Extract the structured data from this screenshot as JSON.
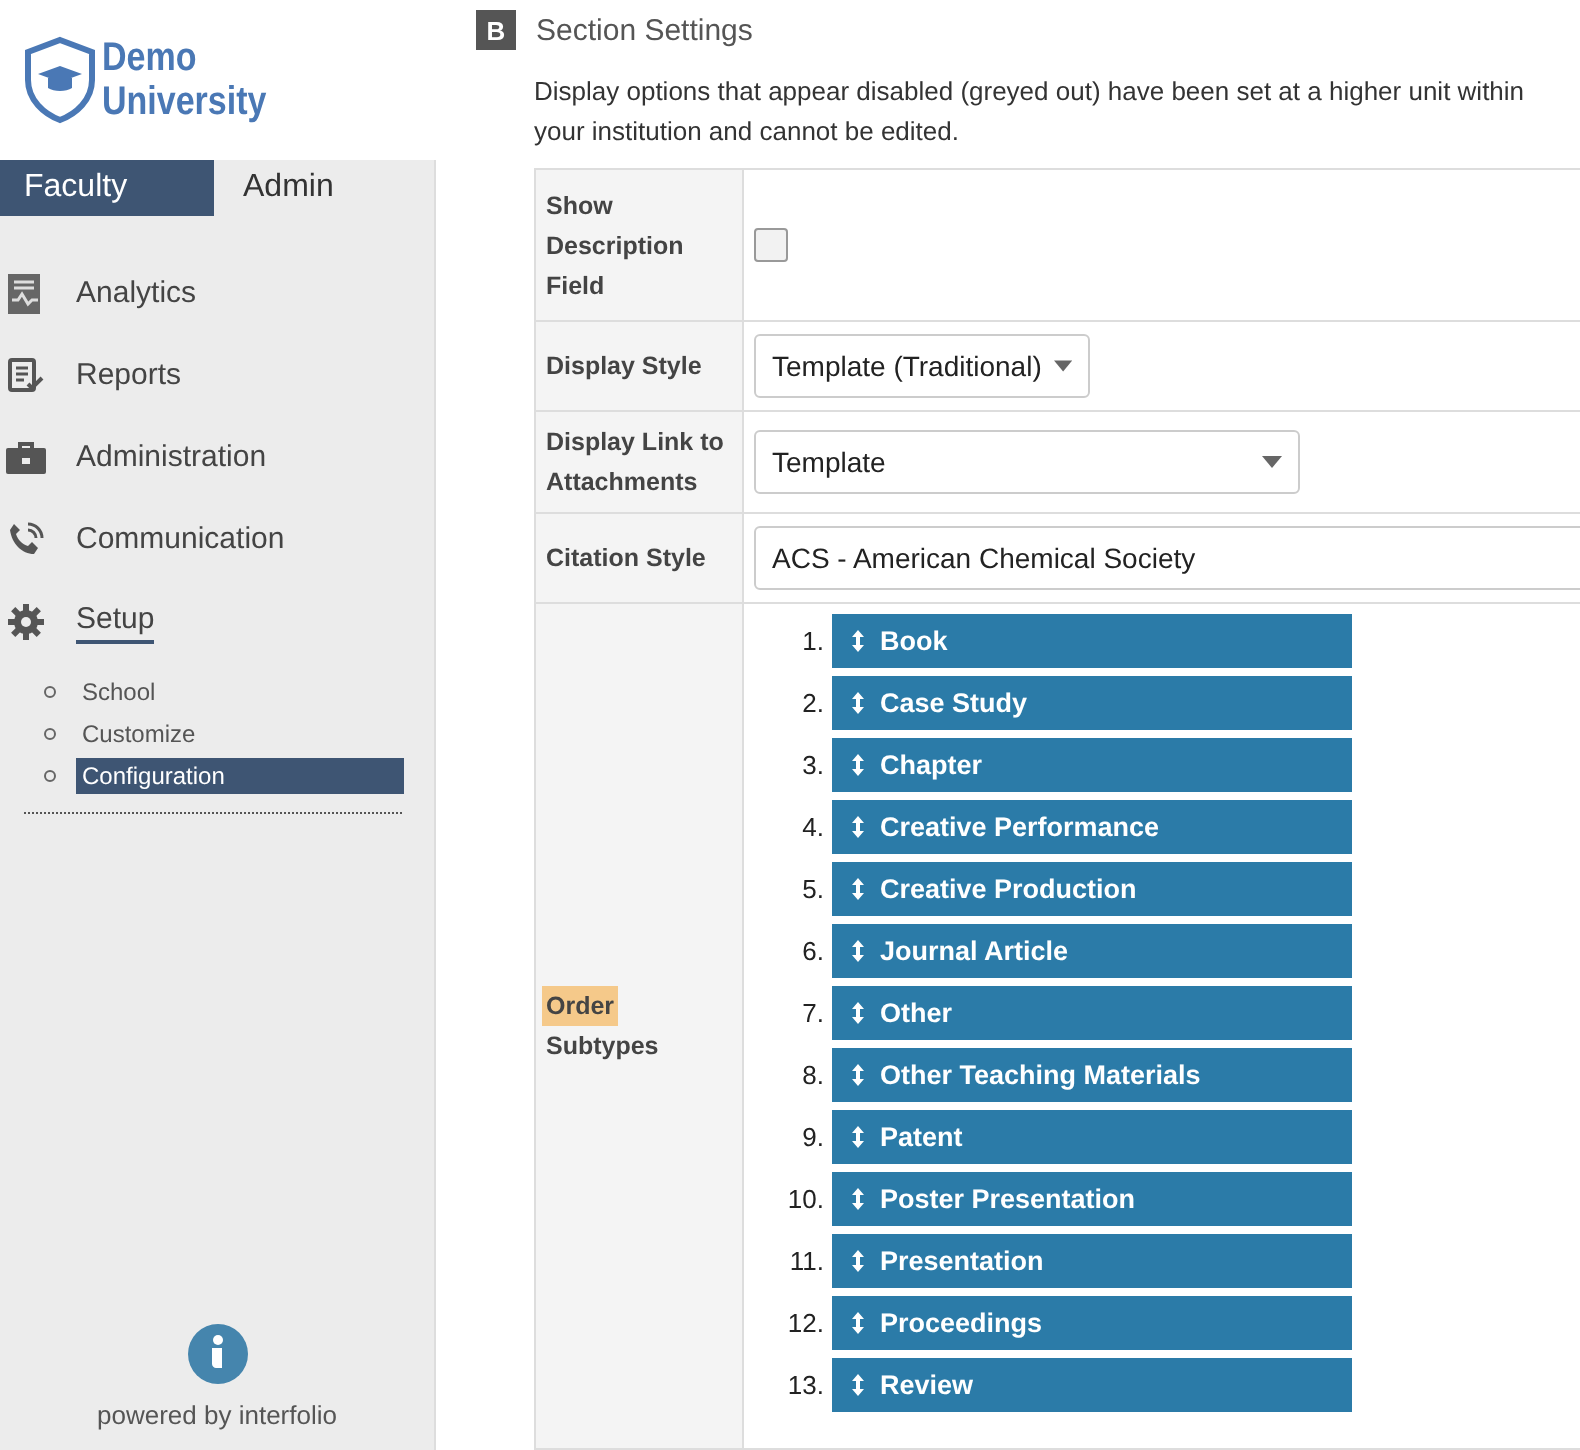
{
  "logo": {
    "line1": "Demo",
    "line2": "University"
  },
  "tabs": [
    {
      "label": "Faculty",
      "selected": true
    },
    {
      "label": "Admin",
      "selected": false
    }
  ],
  "nav": [
    {
      "label": "Analytics",
      "kind": "analytics",
      "selected": false
    },
    {
      "label": "Reports",
      "kind": "reports",
      "selected": false
    },
    {
      "label": "Administration",
      "kind": "briefcase",
      "selected": false
    },
    {
      "label": "Communication",
      "kind": "phone",
      "selected": false
    },
    {
      "label": "Setup",
      "kind": "gear",
      "selected": true,
      "children": [
        {
          "label": "School",
          "selected": false
        },
        {
          "label": "Customize",
          "selected": false
        },
        {
          "label": "Configuration",
          "selected": true
        }
      ]
    }
  ],
  "footer": {
    "text": "powered by interfolio"
  },
  "section": {
    "badge": "B",
    "title": "Section Settings",
    "note": "Display options that appear disabled (greyed out) have been set at a higher unit within your institution and cannot be edited."
  },
  "settings": [
    {
      "kind": "checkbox",
      "label": "Show Description Field",
      "checked": false
    },
    {
      "kind": "select",
      "label": "Display Style",
      "value": "Template (Traditional)"
    },
    {
      "kind": "select",
      "label": "Display Link to Attachments",
      "value": "Template"
    },
    {
      "kind": "field",
      "label": "Citation Style",
      "value": "ACS - American Chemical Society"
    },
    {
      "kind": "order",
      "label_parts": [
        {
          "text": "Order",
          "highlighted": true
        },
        {
          "text": "Subtypes",
          "highlighted": false
        }
      ],
      "items": [
        {
          "number": "1.",
          "label": "Book"
        },
        {
          "number": "2.",
          "label": "Case Study"
        },
        {
          "number": "3.",
          "label": "Chapter"
        },
        {
          "number": "4.",
          "label": "Creative Performance"
        },
        {
          "number": "5.",
          "label": "Creative Production"
        },
        {
          "number": "6.",
          "label": "Journal Article"
        },
        {
          "number": "7.",
          "label": "Other"
        },
        {
          "number": "8.",
          "label": "Other Teaching Materials"
        },
        {
          "number": "9.",
          "label": "Patent"
        },
        {
          "number": "10.",
          "label": "Poster Presentation"
        },
        {
          "number": "11.",
          "label": "Presentation"
        },
        {
          "number": "12.",
          "label": "Proceedings"
        },
        {
          "number": "13.",
          "label": "Review"
        }
      ]
    }
  ]
}
